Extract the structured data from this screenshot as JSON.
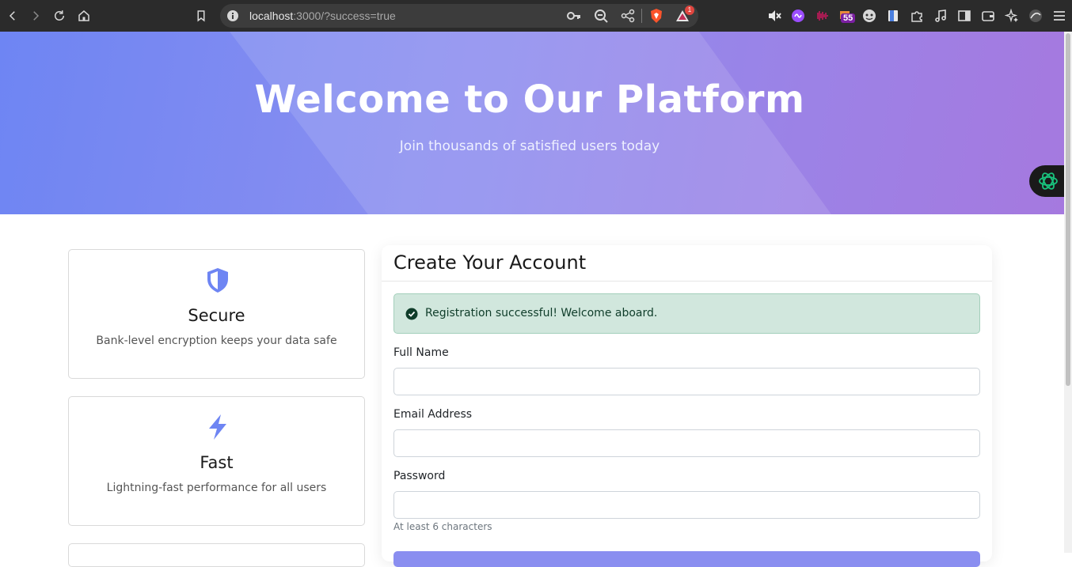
{
  "browser": {
    "url_host": "localhost",
    "url_rest": ":3000/?success=true",
    "tab_badge_count": "55",
    "notification_count": "1"
  },
  "hero": {
    "title": "Welcome to Our Platform",
    "subtitle": "Join thousands of satisfied users today"
  },
  "features": [
    {
      "icon": "shield-icon",
      "title": "Secure",
      "description": "Bank-level encryption keeps your data safe"
    },
    {
      "icon": "lightning-icon",
      "title": "Fast",
      "description": "Lightning-fast performance for all users"
    }
  ],
  "form": {
    "title": "Create Your Account",
    "alert": "Registration successful! Welcome aboard.",
    "fields": [
      {
        "label": "Full Name",
        "value": ""
      },
      {
        "label": "Email Address",
        "value": ""
      },
      {
        "label": "Password",
        "value": "",
        "help": "At least 6 characters"
      }
    ]
  },
  "colors": {
    "accent": "#6e85f3",
    "success_bg": "#d1e7dd",
    "success_icon": "#0f3d2a"
  }
}
